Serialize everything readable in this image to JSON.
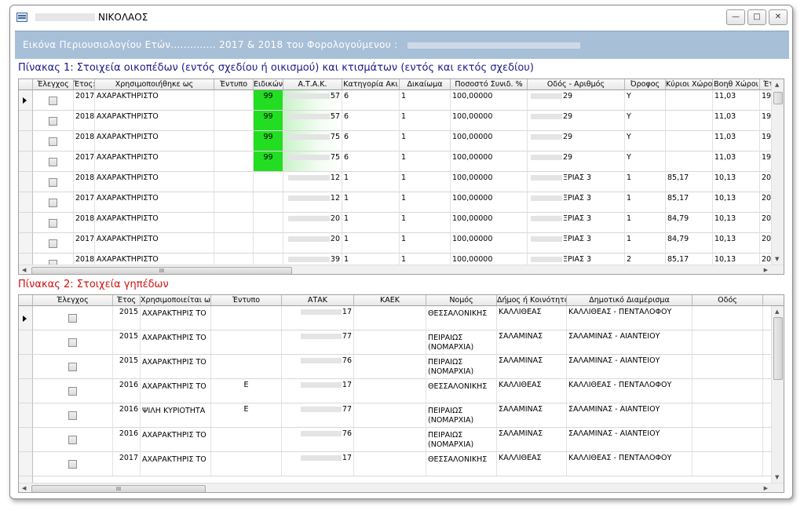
{
  "window": {
    "title": "ΝΙΚΟΛΑΟΣ",
    "buttons": [
      "—",
      "□",
      "✕"
    ]
  },
  "header": {
    "text": "Εικόνα Περιουσιολογίου Ετών.............. 2017 & 2018 του Φορολογούμενου :"
  },
  "table1": {
    "title": "Πίνακας 1: Στοιχεία οικοπέδων (εντός σχεδίου ή οικισμού) και κτισμάτων (εντός και εκτός σχεδίου)",
    "columns": [
      "Έλεγχος",
      "Έτος:",
      "Χρησιμοποιήθηκε ως",
      "Έντυπο",
      "Ειδικών",
      "Α.Τ.Α.Κ.",
      "Κατηγορία Ακι",
      "Δικαίωμα",
      "Ποσοστό Συνιδ. %",
      "Οδός - Αριθμός",
      "Όροφος",
      "Κύριοι Χώροι",
      "Βοηθ Χώροι",
      "Έτ"
    ],
    "rows": [
      {
        "etos": "2017",
        "xrisi": "ΑΧΑΡΑΚΤΗΡΙΣΤΟ",
        "entypo": "",
        "eidikon": "99",
        "atak": "57",
        "kat": "6",
        "dik": "1",
        "pososto": "100,00000",
        "odos": "29",
        "orofos": "Υ",
        "kyrioi": "",
        "voith": "11,03",
        "et": "199"
      },
      {
        "etos": "2018",
        "xrisi": "ΑΧΑΡΑΚΤΗΡΙΣΤΟ",
        "entypo": "",
        "eidikon": "99",
        "atak": "57",
        "kat": "6",
        "dik": "1",
        "pososto": "100,00000",
        "odos": "29",
        "orofos": "Υ",
        "kyrioi": "",
        "voith": "11,03",
        "et": "199"
      },
      {
        "etos": "2018",
        "xrisi": "ΑΧΑΡΑΚΤΗΡΙΣΤΟ",
        "entypo": "",
        "eidikon": "99",
        "atak": "75",
        "kat": "6",
        "dik": "1",
        "pososto": "100,00000",
        "odos": "29",
        "orofos": "Υ",
        "kyrioi": "",
        "voith": "11,03",
        "et": "199"
      },
      {
        "etos": "2017",
        "xrisi": "ΑΧΑΡΑΚΤΗΡΙΣΤΟ",
        "entypo": "",
        "eidikon": "99",
        "atak": "75",
        "kat": "6",
        "dik": "1",
        "pososto": "100,00000",
        "odos": "29",
        "orofos": "Υ",
        "kyrioi": "",
        "voith": "11,03",
        "et": "199"
      },
      {
        "etos": "2018",
        "xrisi": "ΑΧΑΡΑΚΤΗΡΙΣΤΟ",
        "entypo": "",
        "eidikon": "",
        "atak": "12",
        "kat": "1",
        "dik": "1",
        "pososto": "100,00000",
        "odos": "ΞΡΙΑΣ 3",
        "orofos": "1",
        "kyrioi": "85,17",
        "voith": "10,13",
        "et": "200"
      },
      {
        "etos": "2017",
        "xrisi": "ΑΧΑΡΑΚΤΗΡΙΣΤΟ",
        "entypo": "",
        "eidikon": "",
        "atak": "12",
        "kat": "1",
        "dik": "1",
        "pososto": "100,00000",
        "odos": "ΞΡΙΑΣ 3",
        "orofos": "1",
        "kyrioi": "85,17",
        "voith": "10,13",
        "et": "200"
      },
      {
        "etos": "2018",
        "xrisi": "ΑΧΑΡΑΚΤΗΡΙΣΤΟ",
        "entypo": "",
        "eidikon": "",
        "atak": "20",
        "kat": "1",
        "dik": "1",
        "pososto": "100,00000",
        "odos": "ΞΡΙΑΣ 3",
        "orofos": "1",
        "kyrioi": "84,79",
        "voith": "10,13",
        "et": "200"
      },
      {
        "etos": "2017",
        "xrisi": "ΑΧΑΡΑΚΤΗΡΙΣΤΟ",
        "entypo": "",
        "eidikon": "",
        "atak": "20",
        "kat": "1",
        "dik": "1",
        "pososto": "100,00000",
        "odos": "ΞΡΙΑΣ 3",
        "orofos": "1",
        "kyrioi": "84,79",
        "voith": "10,13",
        "et": "200"
      },
      {
        "etos": "2018",
        "xrisi": "ΑΧΑΡΑΚΤΗΡΙΣΤΟ",
        "entypo": "",
        "eidikon": "",
        "atak": "39",
        "kat": "1",
        "dik": "1",
        "pososto": "100,00000",
        "odos": "ΞΡΙΑΣ 3",
        "orofos": "2",
        "kyrioi": "85,17",
        "voith": "10,13",
        "et": "200"
      }
    ]
  },
  "table2": {
    "title": "Πίνακας 2: Στοιχεία γηπέδων",
    "columns": [
      "Έλεγχος",
      "Έτος",
      "Χρησιμοποιείται ω",
      "Έντυπο",
      "ΑΤΑΚ",
      "ΚΑΕΚ",
      "Νομός",
      "Δήμος ή Κοινότητα",
      "Δημοτικό Διαμέρισμα",
      "Οδός"
    ],
    "rows": [
      {
        "etos": "2015",
        "xrisi": "ΑΧΑΡΑΚΤΗΡΙΣ ΤΟ",
        "entypo": "",
        "atak": "17",
        "kaek": "",
        "nomos": "ΘΕΣΣΑΛΟΝΙΚΗΣ",
        "dimos": "ΚΑΛΛΙΘΕΑΣ",
        "diamerisma": "ΚΑΛΛΙΘΕΑΣ - ΠΕΝΤΑΛΟΦΟΥ",
        "odos": ""
      },
      {
        "etos": "2015",
        "xrisi": "ΑΧΑΡΑΚΤΗΡΙΣ ΤΟ",
        "entypo": "",
        "atak": "77",
        "kaek": "",
        "nomos": "ΠΕΙΡΑΙΩΣ (ΝΟΜΑΡΧΙΑ)",
        "dimos": "ΣΑΛΑΜΙΝΑΣ",
        "diamerisma": "ΣΑΛΑΜΙΝΑΣ - ΑΙΑΝΤΕΙΟΥ",
        "odos": ""
      },
      {
        "etos": "2015",
        "xrisi": "ΑΧΑΡΑΚΤΗΡΙΣ ΤΟ",
        "entypo": "",
        "atak": "76",
        "kaek": "",
        "nomos": "ΠΕΙΡΑΙΩΣ (ΝΟΜΑΡΧΙΑ)",
        "dimos": "ΣΑΛΑΜΙΝΑΣ",
        "diamerisma": "ΣΑΛΑΜΙΝΑΣ - ΑΙΑΝΤΕΙΟΥ",
        "odos": ""
      },
      {
        "etos": "2016",
        "xrisi": "ΑΧΑΡΑΚΤΗΡΙΣ ΤΟ",
        "entypo": "Ε",
        "atak": "17",
        "kaek": "",
        "nomos": "ΘΕΣΣΑΛΟΝΙΚΗΣ",
        "dimos": "ΚΑΛΛΙΘΕΑΣ",
        "diamerisma": "ΚΑΛΛΙΘΕΑΣ - ΠΕΝΤΑΛΟΦΟΥ",
        "odos": ""
      },
      {
        "etos": "2016",
        "xrisi": "ΨΙΛΗ ΚΥΡΙΟΤΗΤΑ",
        "entypo": "Ε",
        "atak": "77",
        "kaek": "",
        "nomos": "ΠΕΙΡΑΙΩΣ (ΝΟΜΑΡΧΙΑ)",
        "dimos": "ΣΑΛΑΜΙΝΑΣ",
        "diamerisma": "ΣΑΛΑΜΙΝΑΣ - ΑΙΑΝΤΕΙΟΥ",
        "odos": ""
      },
      {
        "etos": "2016",
        "xrisi": "ΑΧΑΡΑΚΤΗΡΙΣ ΤΟ",
        "entypo": "",
        "atak": "76",
        "kaek": "",
        "nomos": "ΠΕΙΡΑΙΩΣ (ΝΟΜΑΡΧΙΑ)",
        "dimos": "ΣΑΛΑΜΙΝΑΣ",
        "diamerisma": "ΣΑΛΑΜΙΝΑΣ - ΑΙΑΝΤΕΙΟΥ",
        "odos": ""
      },
      {
        "etos": "2017",
        "xrisi": "ΑΧΑΡΑΚΤΗΡΙΣ ΤΟ",
        "entypo": "",
        "atak": "17",
        "kaek": "",
        "nomos": "ΘΕΣΣΑΛΟΝΙΚΗΣ",
        "dimos": "ΚΑΛΛΙΘΕΑΣ",
        "diamerisma": "ΚΑΛΛΙΘΕΑΣ - ΠΕΝΤΑΛΟΦΟΥ",
        "odos": ""
      }
    ]
  },
  "colors": {
    "header_band": "#a8bfd8",
    "table1_title": "#1a1a8c",
    "table2_title": "#d01010",
    "special_cell": "#22dd22"
  },
  "scrollbar_glyph": "III"
}
